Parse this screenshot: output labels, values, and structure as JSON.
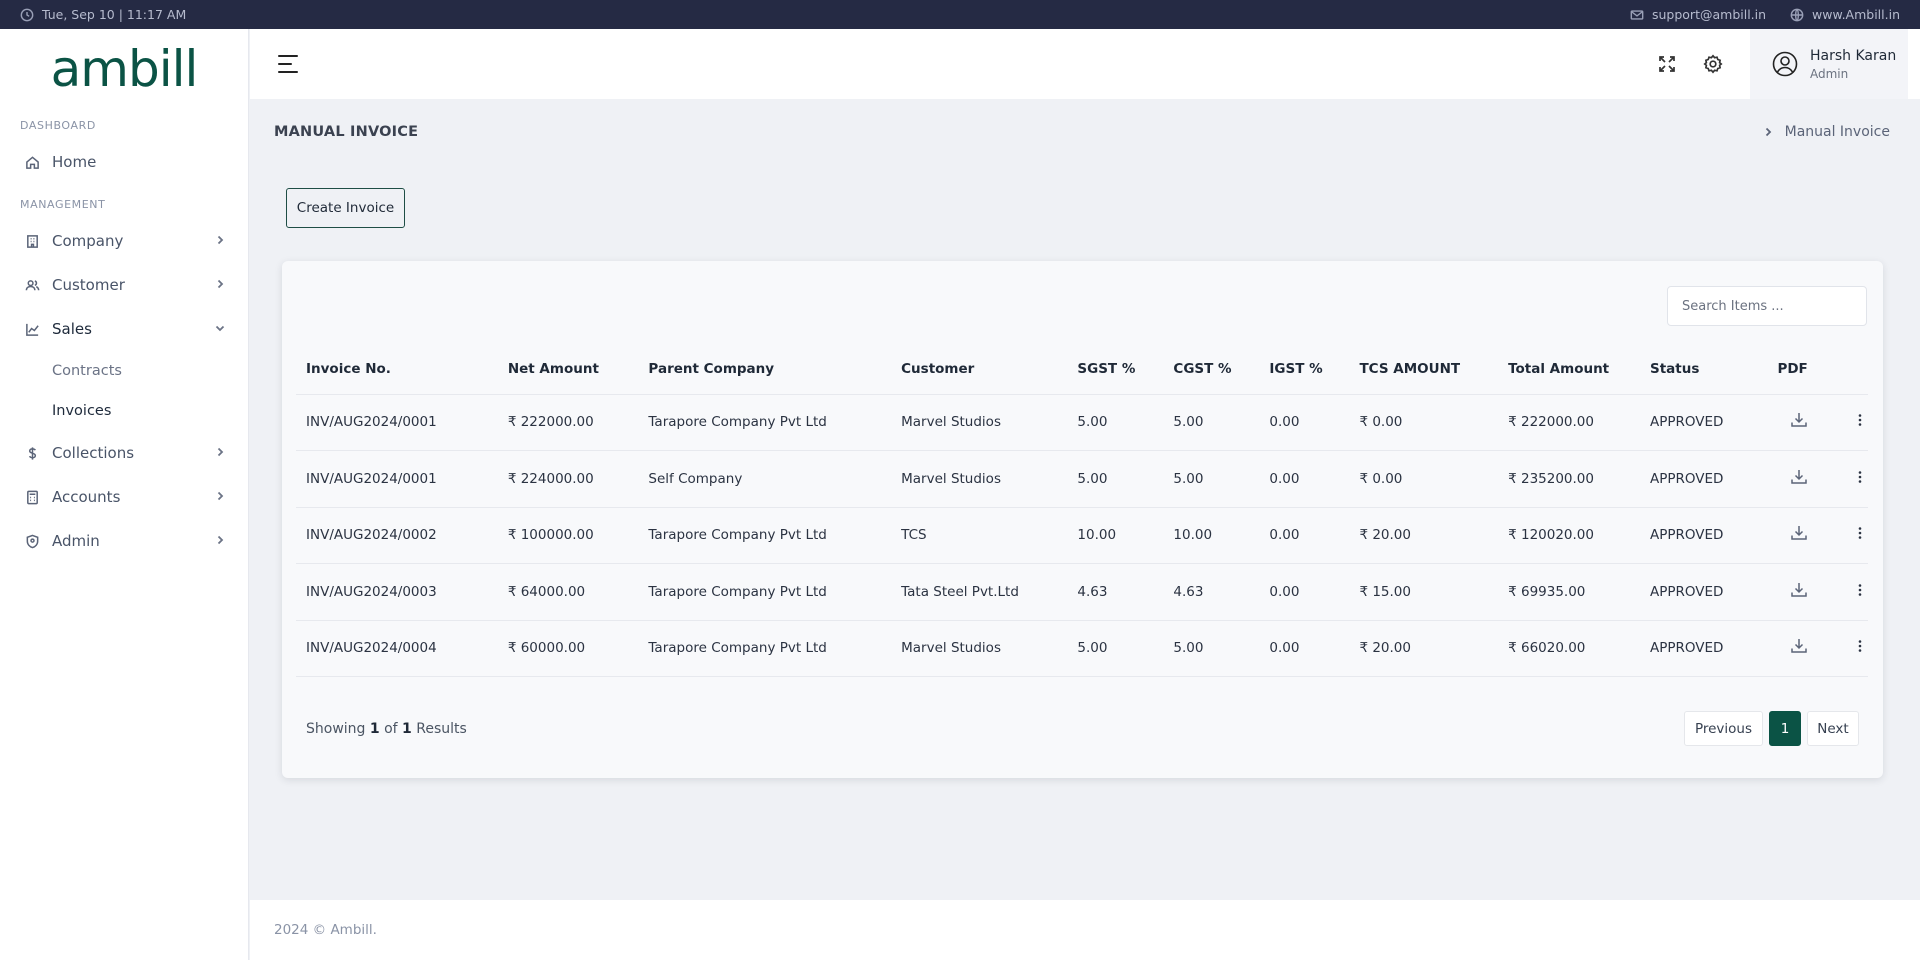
{
  "topbar": {
    "datetime": "Tue, Sep 10 | 11:17 AM",
    "email": "support@ambill.in",
    "website": "www.Ambill.in"
  },
  "brand": {
    "logo_text": "ambill",
    "color": "#0b5345"
  },
  "sidebar": {
    "section_dashboard": "DASHBOARD",
    "section_management": "MANAGEMENT",
    "items": [
      {
        "label": "Home",
        "icon": "home-icon"
      },
      {
        "label": "Company",
        "icon": "building-icon"
      },
      {
        "label": "Customer",
        "icon": "users-icon"
      },
      {
        "label": "Sales",
        "icon": "chart-line-icon"
      },
      {
        "label": "Collections",
        "icon": "dollar-icon"
      },
      {
        "label": "Accounts",
        "icon": "calculator-icon"
      },
      {
        "label": "Admin",
        "icon": "shield-icon"
      }
    ],
    "sales_sub": [
      {
        "label": "Contracts"
      },
      {
        "label": "Invoices"
      }
    ]
  },
  "header": {
    "user_name": "Harsh Karan",
    "user_role": "Admin"
  },
  "page": {
    "title": "MANUAL INVOICE",
    "breadcrumb": "Manual Invoice",
    "create_button": "Create Invoice",
    "search_placeholder": "Search Items ..."
  },
  "table": {
    "columns": [
      "Invoice No.",
      "Net Amount",
      "Parent Company",
      "Customer",
      "SGST %",
      "CGST %",
      "IGST %",
      "TCS AMOUNT",
      "Total Amount",
      "Status",
      "PDF"
    ],
    "rows": [
      [
        "INV/AUG2024/0001",
        "₹ 222000.00",
        "Tarapore Company Pvt Ltd",
        "Marvel Studios",
        "5.00",
        "5.00",
        "0.00",
        "₹ 0.00",
        "₹ 222000.00",
        "APPROVED"
      ],
      [
        "INV/AUG2024/0001",
        "₹ 224000.00",
        "Self Company",
        "Marvel Studios",
        "5.00",
        "5.00",
        "0.00",
        "₹ 0.00",
        "₹ 235200.00",
        "APPROVED"
      ],
      [
        "INV/AUG2024/0002",
        "₹ 100000.00",
        "Tarapore Company Pvt Ltd",
        "TCS",
        "10.00",
        "10.00",
        "0.00",
        "₹ 20.00",
        "₹ 120020.00",
        "APPROVED"
      ],
      [
        "INV/AUG2024/0003",
        "₹ 64000.00",
        "Tarapore Company Pvt Ltd",
        "Tata Steel Pvt.Ltd",
        "4.63",
        "4.63",
        "0.00",
        "₹ 15.00",
        "₹ 69935.00",
        "APPROVED"
      ],
      [
        "INV/AUG2024/0004",
        "₹ 60000.00",
        "Tarapore Company Pvt Ltd",
        "Marvel Studios",
        "5.00",
        "5.00",
        "0.00",
        "₹ 20.00",
        "₹ 66020.00",
        "APPROVED"
      ]
    ]
  },
  "pagination": {
    "showing_prefix": "Showing",
    "current": "1",
    "of_word": "of",
    "total": "1",
    "results_word": "Results",
    "previous": "Previous",
    "page": "1",
    "next": "Next"
  },
  "footer": {
    "text": "2024 © Ambill."
  }
}
